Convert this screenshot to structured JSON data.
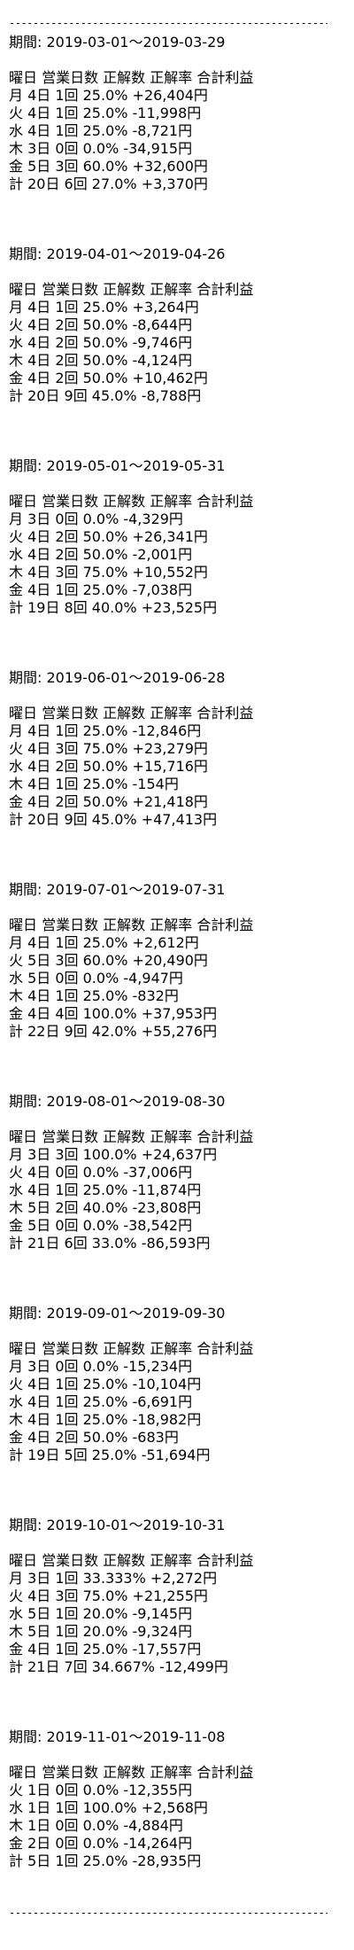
{
  "rule": "------------------------------------------------------------",
  "header": "曜日 営業日数 正解数 正解率 合計利益",
  "sections": [
    {
      "period": "期間: 2019-03-01～2019-03-29",
      "rows": [
        "月 4日 1回 25.0% +26,404円",
        "火 4日 1回 25.0% -11,998円",
        "水 4日 1回 25.0% -8,721円",
        "木 3日 0回 0.0% -34,915円",
        "金 5日 3回 60.0% +32,600円",
        "計 20日 6回 27.0% +3,370円"
      ]
    },
    {
      "period": "期間: 2019-04-01～2019-04-26",
      "rows": [
        "月 4日 1回 25.0% +3,264円",
        "火 4日 2回 50.0% -8,644円",
        "水 4日 2回 50.0% -9,746円",
        "木 4日 2回 50.0% -4,124円",
        "金 4日 2回 50.0% +10,462円",
        "計 20日 9回 45.0% -8,788円"
      ]
    },
    {
      "period": "期間: 2019-05-01～2019-05-31",
      "rows": [
        "月 3日 0回 0.0% -4,329円",
        "火 4日 2回 50.0% +26,341円",
        "水 4日 2回 50.0% -2,001円",
        "木 4日 3回 75.0% +10,552円",
        "金 4日 1回 25.0% -7,038円",
        "計 19日 8回 40.0% +23,525円"
      ]
    },
    {
      "period": "期間: 2019-06-01～2019-06-28",
      "rows": [
        "月 4日 1回 25.0% -12,846円",
        "火 4日 3回 75.0% +23,279円",
        "水 4日 2回 50.0% +15,716円",
        "木 4日 1回 25.0% -154円",
        "金 4日 2回 50.0% +21,418円",
        "計 20日 9回 45.0% +47,413円"
      ]
    },
    {
      "period": "期間: 2019-07-01～2019-07-31",
      "rows": [
        "月 4日 1回 25.0% +2,612円",
        "火 5日 3回 60.0% +20,490円",
        "水 5日 0回 0.0% -4,947円",
        "木 4日 1回 25.0% -832円",
        "金 4日 4回 100.0% +37,953円",
        "計 22日 9回 42.0% +55,276円"
      ]
    },
    {
      "period": "期間: 2019-08-01～2019-08-30",
      "rows": [
        "月 3日 3回 100.0% +24,637円",
        "火 4日 0回 0.0% -37,006円",
        "水 4日 1回 25.0% -11,874円",
        "木 5日 2回 40.0% -23,808円",
        "金 5日 0回 0.0% -38,542円",
        "計 21日 6回 33.0% -86,593円"
      ]
    },
    {
      "period": "期間: 2019-09-01～2019-09-30",
      "rows": [
        "月 3日 0回 0.0% -15,234円",
        "火 4日 1回 25.0% -10,104円",
        "水 4日 1回 25.0% -6,691円",
        "木 4日 1回 25.0% -18,982円",
        "金 4日 2回 50.0% -683円",
        "計 19日 5回 25.0% -51,694円"
      ]
    },
    {
      "period": "期間: 2019-10-01～2019-10-31",
      "rows": [
        "月 3日 1回 33.333% +2,272円",
        "火 4日 3回 75.0% +21,255円",
        "水 5日 1回 20.0% -9,145円",
        "木 5日 1回 20.0% -9,324円",
        "金 4日 1回 25.0% -17,557円",
        "計 21日 7回 34.667% -12,499円"
      ]
    },
    {
      "period": "期間: 2019-11-01～2019-11-08",
      "rows": [
        "火 1日 0回 0.0% -12,355円",
        "水 1日 1回 100.0% +2,568円",
        "木 1日 0回 0.0% -4,884円",
        "金 2日 0回 0.0% -14,264円",
        "計 5日 1回 25.0% -28,935円"
      ]
    }
  ]
}
